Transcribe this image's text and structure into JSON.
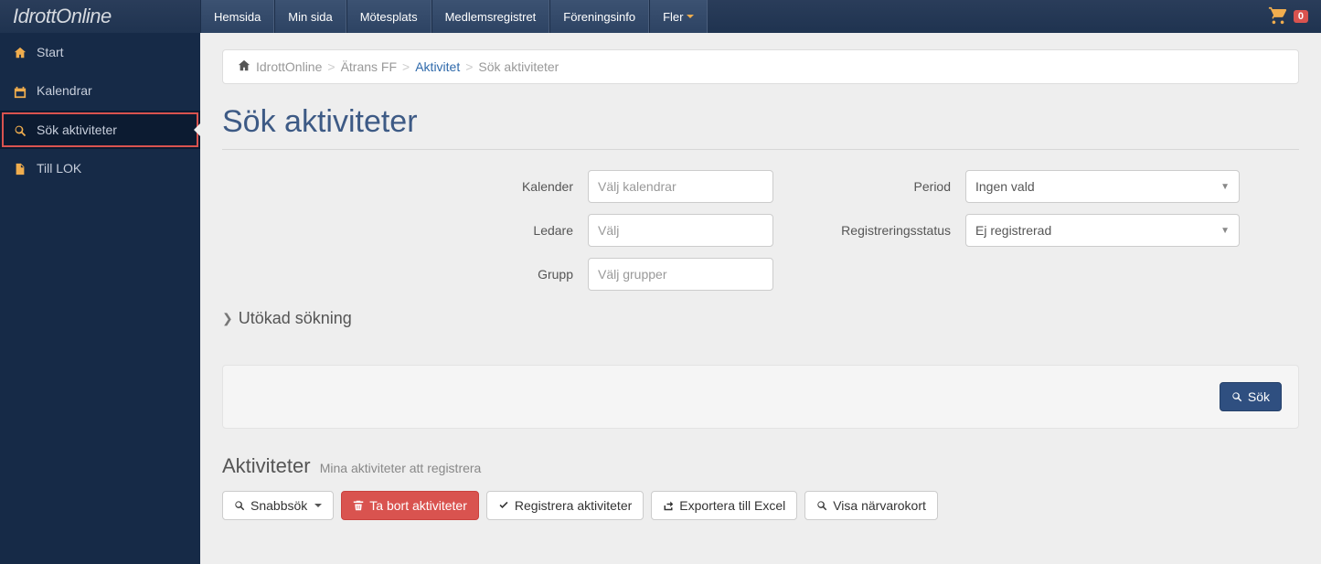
{
  "brand": "IdrottOnline",
  "topnav": {
    "items": [
      "Hemsida",
      "Min sida",
      "Mötesplats",
      "Medlemsregistret",
      "Föreningsinfo",
      "Fler"
    ]
  },
  "cart": {
    "count": "0"
  },
  "sidebar": {
    "items": [
      {
        "label": "Start"
      },
      {
        "label": "Kalendrar"
      },
      {
        "label": "Sök aktiviteter"
      },
      {
        "label": "Till LOK"
      }
    ]
  },
  "breadcrumb": {
    "home": "IdrottOnline",
    "org": "Ätrans FF",
    "section": "Aktivitet",
    "current": "Sök aktiviteter"
  },
  "page": {
    "title": "Sök aktiviteter"
  },
  "form": {
    "kalender_label": "Kalender",
    "kalender_placeholder": "Välj kalendrar",
    "ledare_label": "Ledare",
    "ledare_placeholder": "Välj",
    "grupp_label": "Grupp",
    "grupp_placeholder": "Välj grupper",
    "period_label": "Period",
    "period_value": "Ingen vald",
    "regstatus_label": "Registreringsstatus",
    "regstatus_value": "Ej registrerad",
    "expand_label": "Utökad sökning",
    "search_button": "Sök"
  },
  "activities": {
    "heading": "Aktiviteter",
    "sub": "Mina aktiviteter att registrera",
    "buttons": {
      "quick": "Snabbsök",
      "delete": "Ta bort aktiviteter",
      "register": "Registrera aktiviteter",
      "export": "Exportera till Excel",
      "attendance": "Visa närvarokort"
    }
  }
}
